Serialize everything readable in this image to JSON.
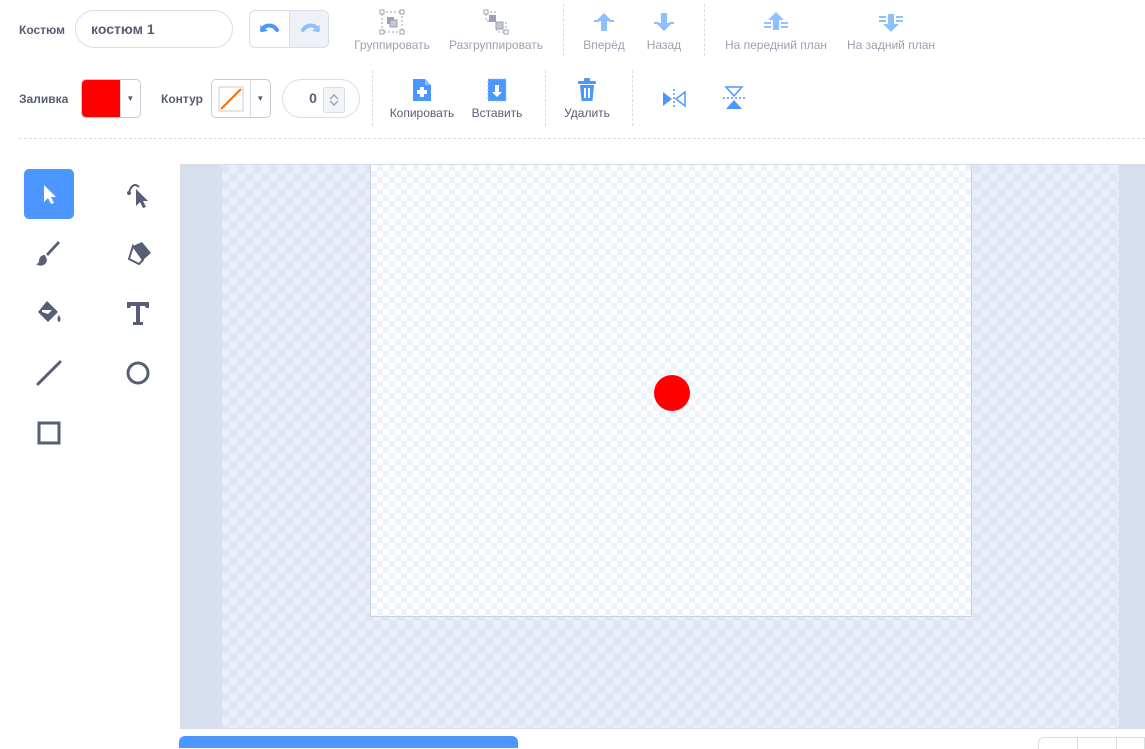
{
  "costume": {
    "label": "Костюм",
    "name_value": "костюм 1"
  },
  "toolbar_top": {
    "group": "Группировать",
    "ungroup": "Разгруппировать",
    "forward": "Вперёд",
    "backward": "Назад",
    "front": "На передний план",
    "back": "На задний план"
  },
  "fill": {
    "label": "Заливка",
    "color": "#ff0000"
  },
  "outline": {
    "label": "Контур",
    "width_value": "0",
    "none_color": "#ff6a00"
  },
  "toolbar_mid": {
    "copy": "Копировать",
    "paste": "Вставить",
    "delete": "Удалить"
  },
  "tools": [
    {
      "name": "select",
      "icon": "select-arrow-icon",
      "active": true
    },
    {
      "name": "reshape",
      "icon": "reshape-icon",
      "active": false
    },
    {
      "name": "brush",
      "icon": "brush-icon",
      "active": false
    },
    {
      "name": "eraser",
      "icon": "eraser-icon",
      "active": false
    },
    {
      "name": "fill",
      "icon": "fill-bucket-icon",
      "active": false
    },
    {
      "name": "text",
      "icon": "text-icon",
      "active": false
    },
    {
      "name": "line",
      "icon": "line-icon",
      "active": false
    },
    {
      "name": "circle",
      "icon": "circle-icon",
      "active": false
    },
    {
      "name": "rectangle",
      "icon": "rectangle-icon",
      "active": false
    }
  ],
  "colors": {
    "accent": "#4c97ff",
    "icon_dark": "#575e75",
    "shape_fill": "#ff0000"
  }
}
